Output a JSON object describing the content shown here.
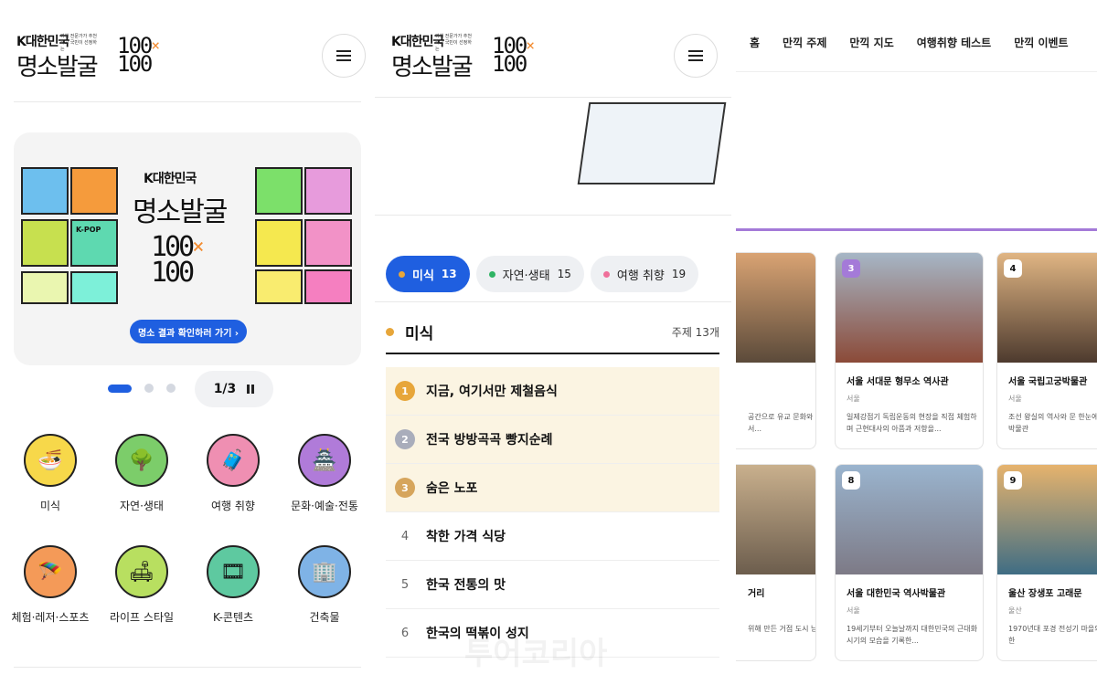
{
  "left": {
    "logo": {
      "small": "K대한민국",
      "tiny": "여행 전문가가 추천하고 국민이 선정하는",
      "big": "명소발굴",
      "num": "100",
      "x": "×",
      "q": "100"
    },
    "banner": {
      "small": "K대한민국",
      "big": "명소발굴",
      "num": "100",
      "x": "×",
      "q": "100",
      "kpop": "K-POP",
      "cta": "명소 결과 확인하러 가기 ›"
    },
    "pager": {
      "text": "1/3"
    },
    "categories": [
      {
        "label": "미식",
        "icon": "🍜",
        "color": "#f7d84a"
      },
      {
        "label": "자연·생태",
        "icon": "🌳",
        "color": "#7ccd6a"
      },
      {
        "label": "여행 취향",
        "icon": "🧳",
        "color": "#ef8fb2"
      },
      {
        "label": "문화·예술·전통",
        "icon": "🏯",
        "color": "#b07bd9"
      },
      {
        "label": "체험·레저·스포츠",
        "icon": "🪂",
        "color": "#f49a58"
      },
      {
        "label": "라이프 스타일",
        "icon": "🛋",
        "color": "#b8df60"
      },
      {
        "label": "K-콘텐츠",
        "icon": "🎞",
        "color": "#5ec9a0"
      },
      {
        "label": "건축물",
        "icon": "🏢",
        "color": "#7fb3e6"
      }
    ]
  },
  "middle": {
    "logo": {
      "small": "K대한민국",
      "tiny": "여행 전문가가 추천하고 국민이 선정하는",
      "big": "명소발굴",
      "num": "100",
      "x": "×",
      "q": "100"
    },
    "chips": [
      {
        "label": "미식",
        "count": "13",
        "dot": "#e7a63a"
      },
      {
        "label": "자연·생태",
        "count": "15",
        "dot": "#2fb464"
      },
      {
        "label": "여행 취향",
        "count": "19",
        "dot": "#ef6f9a"
      }
    ],
    "section": {
      "title": "미식",
      "count": "주제 13개"
    },
    "ranks": [
      {
        "num": "1",
        "text": "지금, 여기서만 제철음식"
      },
      {
        "num": "2",
        "text": "전국 방방곡곡 빵지순례"
      },
      {
        "num": "3",
        "text": "숨은 노포"
      },
      {
        "num": "4",
        "text": "착한 가격 식당"
      },
      {
        "num": "5",
        "text": "한국 전통의 맛"
      },
      {
        "num": "6",
        "text": "한국의 떡볶이 성지"
      }
    ],
    "watermark": "투어코리아"
  },
  "right": {
    "nav": [
      "홈",
      "만끽 주제",
      "만끽 지도",
      "여행취향 테스트",
      "만끽 이벤트"
    ],
    "cards": [
      {
        "badge": "",
        "title": "",
        "region": "",
        "desc": "공간으로 유교 문화와 수 있는 대표 교과서...",
        "colors": [
          "#d9a373",
          "#5b4a3a"
        ]
      },
      {
        "badge": "3",
        "title": "서울 서대문 형무소 역사관",
        "region": "서울",
        "desc": "일제강점기 독립운동의 현장을 직접 체험하며 근현대사의 아픔과 저항을...",
        "colors": [
          "#a6b6c6",
          "#8b4a38"
        ]
      },
      {
        "badge": "4",
        "title": "서울 국립고궁박물관",
        "region": "서울",
        "desc": "조선 왕실의 역사와 문 한눈에 볼 수 있는 박물관",
        "colors": [
          "#e0b583",
          "#4d3a2e"
        ]
      },
      {
        "badge": "",
        "title": "거리",
        "region": "",
        "desc": "위해 만든 거점 도시 남아있는 당시의...",
        "colors": [
          "#c9b08d",
          "#6c5d4d"
        ]
      },
      {
        "badge": "8",
        "title": "서울 대한민국 역사박물관",
        "region": "서울",
        "desc": "19세기부터 오늘날까지 대한민국의 근대화 시기의 모습을 기록한...",
        "colors": [
          "#9ab4ce",
          "#7d7a86"
        ]
      },
      {
        "badge": "9",
        "title": "울산 장생포 고래문",
        "region": "울산",
        "desc": "1970년대 포경 전성기 마을의 풍경을 재현한",
        "colors": [
          "#e6b36d",
          "#3f6d84"
        ]
      }
    ]
  }
}
